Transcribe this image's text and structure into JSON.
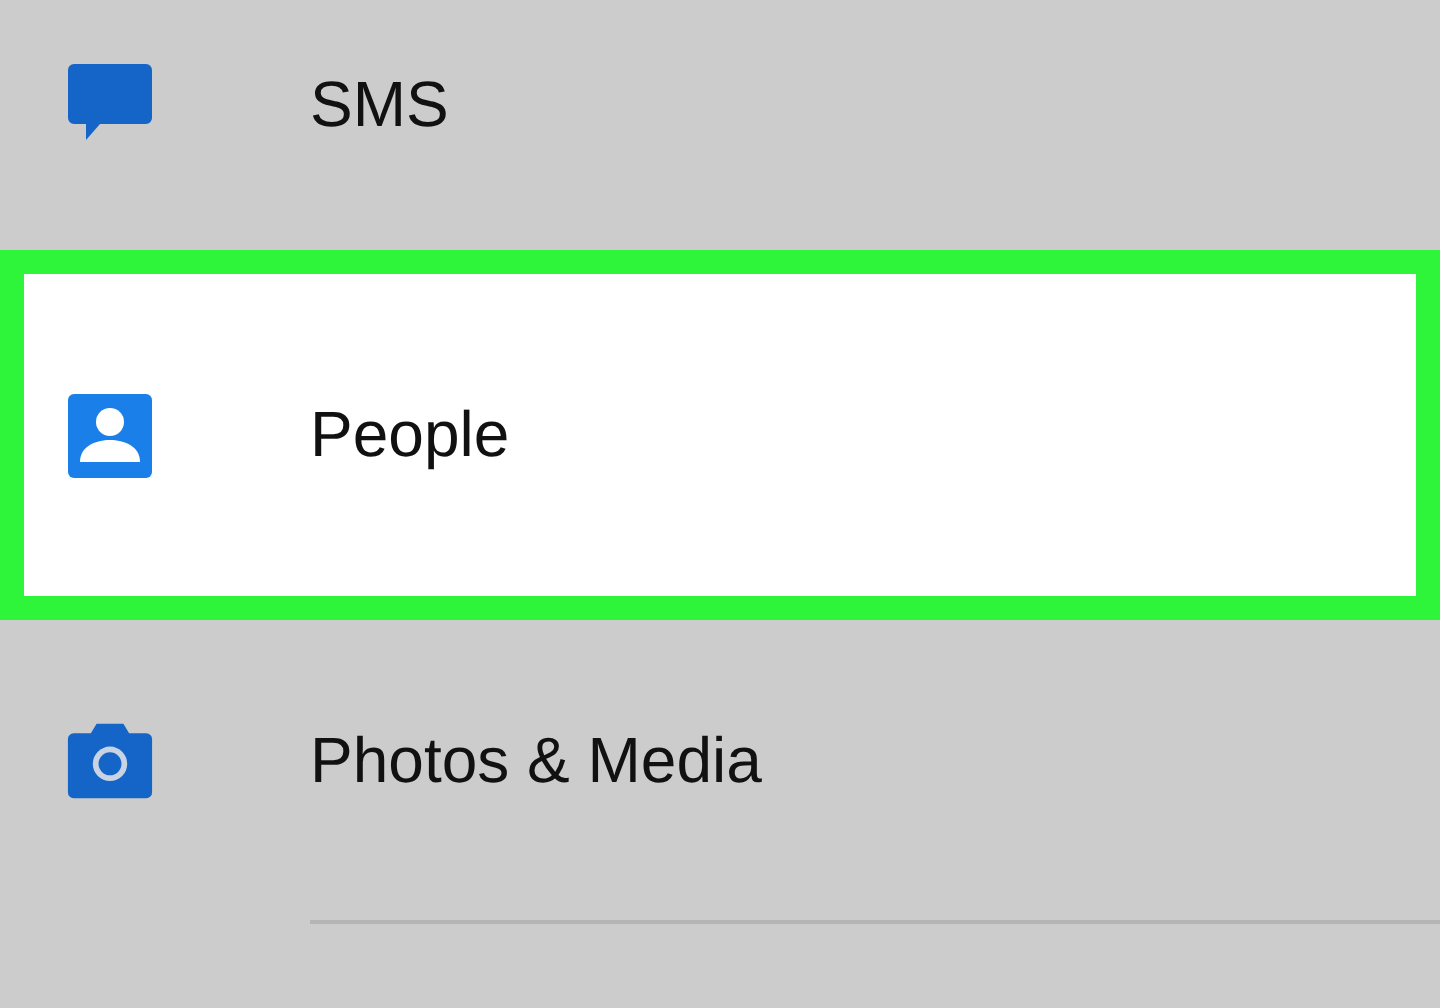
{
  "items": [
    {
      "kind": "sms",
      "label": "SMS",
      "selected": false
    },
    {
      "kind": "people",
      "label": "People",
      "selected": true
    },
    {
      "kind": "camera",
      "label": "Photos & Media",
      "selected": false
    }
  ]
}
